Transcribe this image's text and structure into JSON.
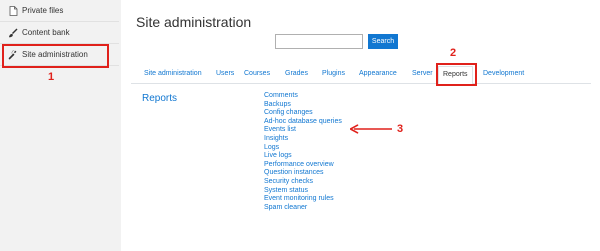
{
  "sidebar": {
    "items": [
      {
        "label": "Private files",
        "icon": "file-icon"
      },
      {
        "label": "Content bank",
        "icon": "brush-icon"
      },
      {
        "label": "Site administration",
        "icon": "wrench-icon"
      }
    ]
  },
  "annotations": {
    "n1": "1",
    "n2": "2",
    "n3": "3"
  },
  "header": {
    "title": "Site administration",
    "search_placeholder": "",
    "search_button": "Search"
  },
  "tabs": [
    "Site administration",
    "Users",
    "Courses",
    "Grades",
    "Plugins",
    "Appearance",
    "Server",
    "Reports",
    "Development"
  ],
  "active_tab": "Reports",
  "reports": {
    "heading": "Reports",
    "links": [
      "Comments",
      "Backups",
      "Config changes",
      "Ad-hoc database queries",
      "Events list",
      "Insights",
      "Logs",
      "Live logs",
      "Performance overview",
      "Question instances",
      "Security checks",
      "System status",
      "Event monitoring rules",
      "Spam cleaner"
    ]
  },
  "colors": {
    "accent": "#1177d1",
    "annotation": "#e0211b"
  }
}
